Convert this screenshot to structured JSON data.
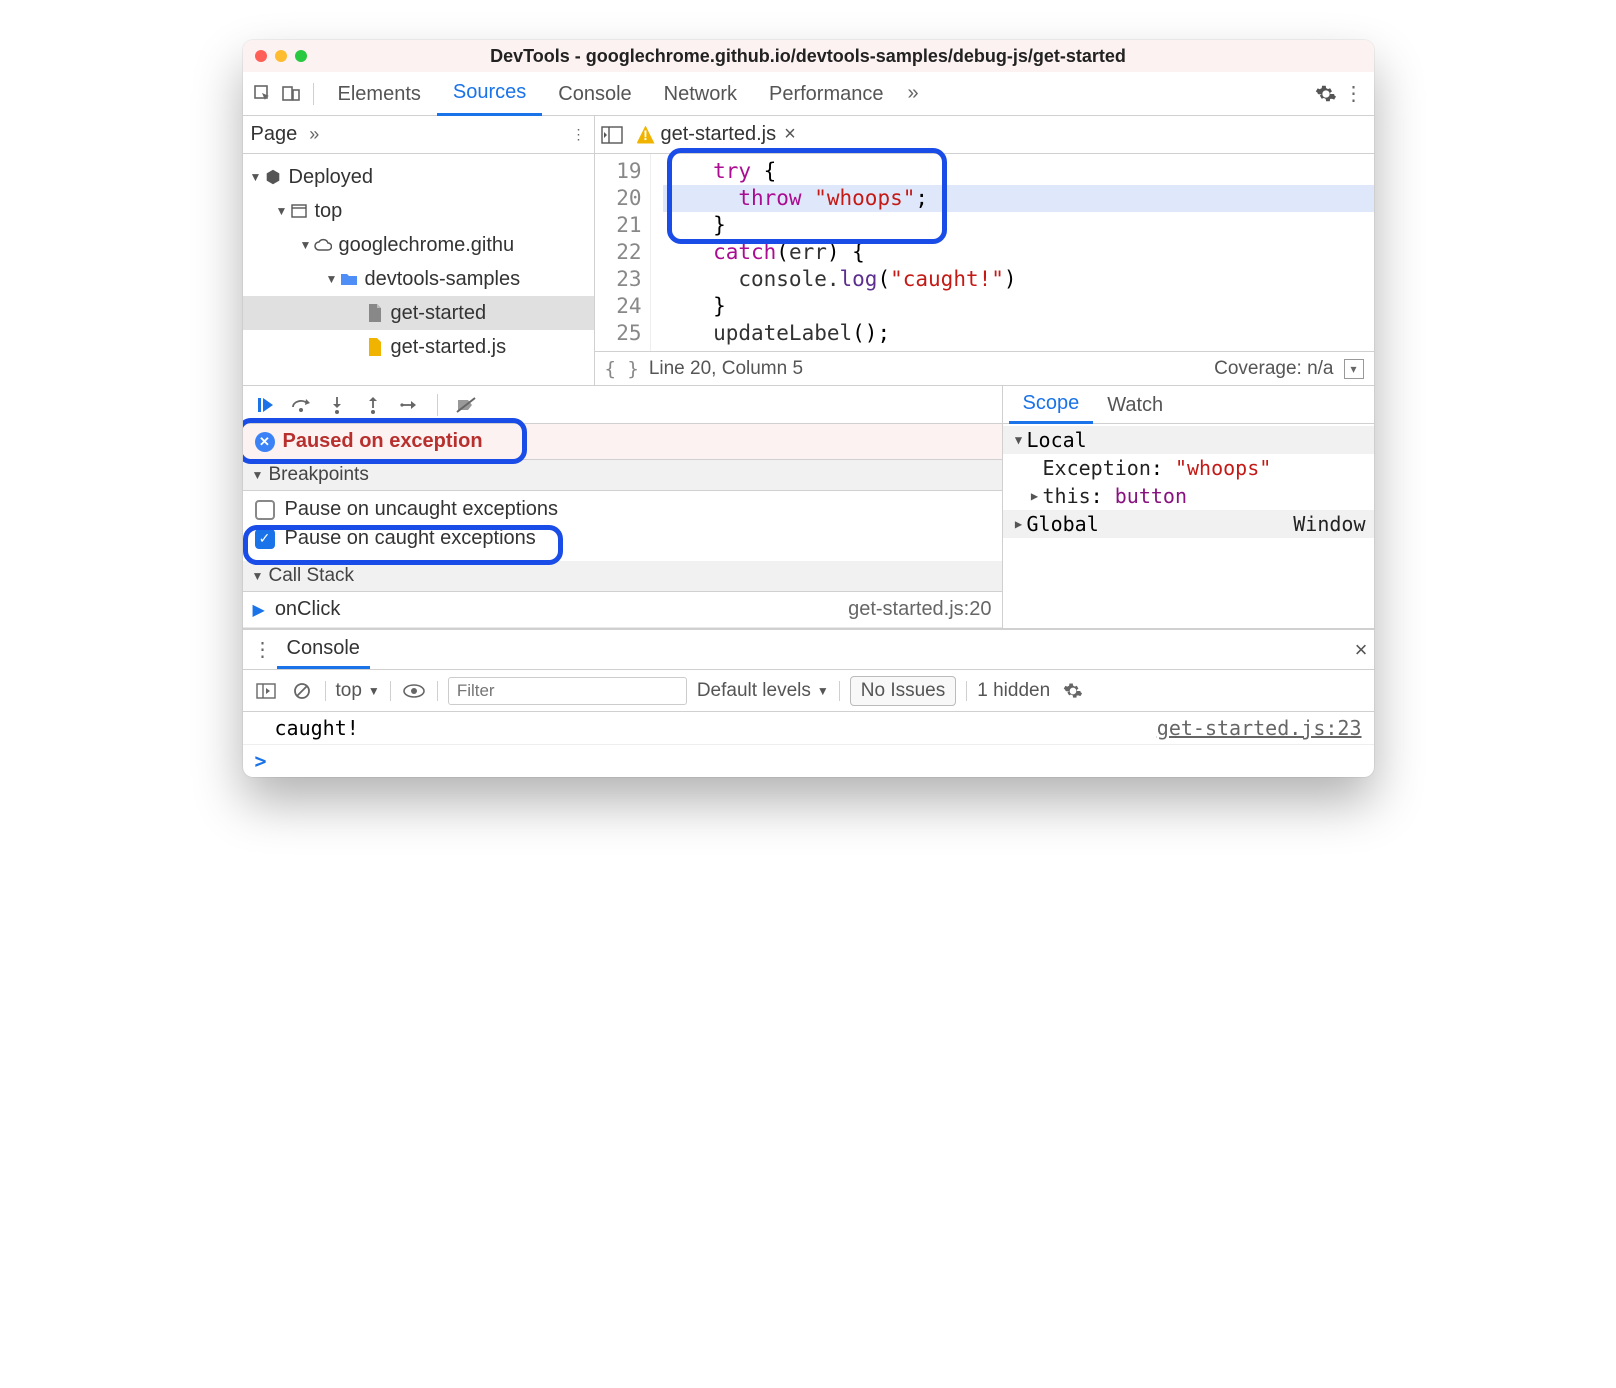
{
  "title": "DevTools - googlechrome.github.io/devtools-samples/debug-js/get-started",
  "tabs": [
    "Elements",
    "Sources",
    "Console",
    "Network",
    "Performance"
  ],
  "active_tab": "Sources",
  "left": {
    "page_label": "Page",
    "tree": {
      "root": "Deployed",
      "top": "top",
      "domain": "googlechrome.githu",
      "folder": "devtools-samples",
      "file_doc": "get-started",
      "file_js": "get-started.js"
    }
  },
  "file_tab": "get-started.js",
  "code": {
    "lines": [
      {
        "n": 19,
        "segs": [
          {
            "t": "    ",
            "cls": ""
          },
          {
            "t": "try",
            "cls": "kw"
          },
          {
            "t": " {",
            "cls": ""
          }
        ]
      },
      {
        "n": 20,
        "segs": [
          {
            "t": "      ",
            "cls": ""
          },
          {
            "t": "throw",
            "cls": "kw"
          },
          {
            "t": " ",
            "cls": ""
          },
          {
            "t": "\"whoops\"",
            "cls": "str"
          },
          {
            "t": ";",
            "cls": ""
          }
        ],
        "hl": true
      },
      {
        "n": 21,
        "segs": [
          {
            "t": "    }",
            "cls": ""
          }
        ]
      },
      {
        "n": 22,
        "segs": [
          {
            "t": "    ",
            "cls": ""
          },
          {
            "t": "catch",
            "cls": "kw"
          },
          {
            "t": "(",
            "cls": ""
          },
          {
            "t": "err",
            "cls": "fn"
          },
          {
            "t": ") {",
            "cls": ""
          }
        ]
      },
      {
        "n": 23,
        "segs": [
          {
            "t": "      console.",
            "cls": "fn"
          },
          {
            "t": "log",
            "cls": "fncall"
          },
          {
            "t": "(",
            "cls": ""
          },
          {
            "t": "\"caught!\"",
            "cls": "str"
          },
          {
            "t": ")",
            "cls": ""
          }
        ]
      },
      {
        "n": 24,
        "segs": [
          {
            "t": "    }",
            "cls": ""
          }
        ]
      },
      {
        "n": 25,
        "segs": [
          {
            "t": "    ",
            "cls": ""
          },
          {
            "t": "updateLabel",
            "cls": "fn"
          },
          {
            "t": "();",
            "cls": ""
          }
        ]
      }
    ]
  },
  "statusbar": {
    "pos": "Line 20, Column 5",
    "coverage": "Coverage: n/a"
  },
  "paused_label": "Paused on exception",
  "breakpoints": {
    "header": "Breakpoints",
    "uncaught": "Pause on uncaught exceptions",
    "caught": "Pause on caught exceptions"
  },
  "callstack": {
    "header": "Call Stack",
    "frames": [
      {
        "name": "onClick",
        "loc": "get-started.js:20"
      }
    ]
  },
  "scope": {
    "tabs": [
      "Scope",
      "Watch"
    ],
    "local_label": "Local",
    "local": [
      {
        "k": "Exception",
        "v": "\"whoops\"",
        "vcls": "val"
      },
      {
        "k": "this",
        "v": "button",
        "vcls": "prop",
        "tri": "▶"
      }
    ],
    "global_label": "Global",
    "global_val": "Window"
  },
  "drawer": {
    "tab": "Console",
    "context": "top",
    "filter_placeholder": "Filter",
    "levels": "Default levels",
    "issues": "No Issues",
    "hidden": "1 hidden",
    "log": {
      "msg": "caught!",
      "src": "get-started.js:23"
    }
  }
}
